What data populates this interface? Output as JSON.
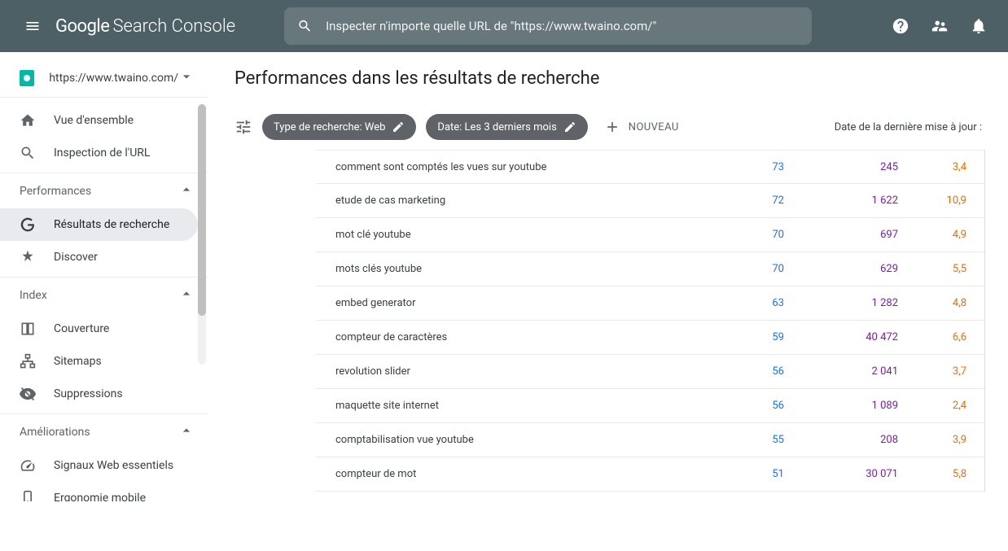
{
  "header": {
    "logo_main": "Google",
    "logo_sub": "Search Console",
    "search_placeholder": "Inspecter n'importe quelle URL de \"https://www.twaino.com/\""
  },
  "sidebar": {
    "property": "https://www.twaino.com/",
    "overview": "Vue d'ensemble",
    "url_inspection": "Inspection de l'URL",
    "section_perf": "Performances",
    "search_results": "Résultats de recherche",
    "discover": "Discover",
    "section_index": "Index",
    "coverage": "Couverture",
    "sitemaps": "Sitemaps",
    "removals": "Suppressions",
    "section_enh": "Améliorations",
    "web_vitals": "Signaux Web essentiels",
    "mobile": "Ergonomie mobile"
  },
  "main": {
    "title": "Performances dans les résultats de recherche",
    "chip_type": "Type de recherche: Web",
    "chip_date": "Date: Les 3 derniers mois",
    "new_label": "NOUVEAU",
    "update_label": "Date de la dernière mise à jour :",
    "rows": [
      {
        "q": "comment sont comptés les vues sur youtube",
        "clicks": "73",
        "impr": "245",
        "pos": "3,4"
      },
      {
        "q": "etude de cas marketing",
        "clicks": "72",
        "impr": "1 622",
        "pos": "10,9"
      },
      {
        "q": "mot clé youtube",
        "clicks": "70",
        "impr": "697",
        "pos": "4,9"
      },
      {
        "q": "mots clés youtube",
        "clicks": "70",
        "impr": "629",
        "pos": "5,5"
      },
      {
        "q": "embed generator",
        "clicks": "63",
        "impr": "1 282",
        "pos": "4,8"
      },
      {
        "q": "compteur de caractères",
        "clicks": "59",
        "impr": "40 472",
        "pos": "6,6"
      },
      {
        "q": "revolution slider",
        "clicks": "56",
        "impr": "2 041",
        "pos": "3,7"
      },
      {
        "q": "maquette site internet",
        "clicks": "56",
        "impr": "1 089",
        "pos": "2,4"
      },
      {
        "q": "comptabilisation vue youtube",
        "clicks": "55",
        "impr": "208",
        "pos": "3,9"
      },
      {
        "q": "compteur de mot",
        "clicks": "51",
        "impr": "30 071",
        "pos": "5,8"
      }
    ]
  }
}
